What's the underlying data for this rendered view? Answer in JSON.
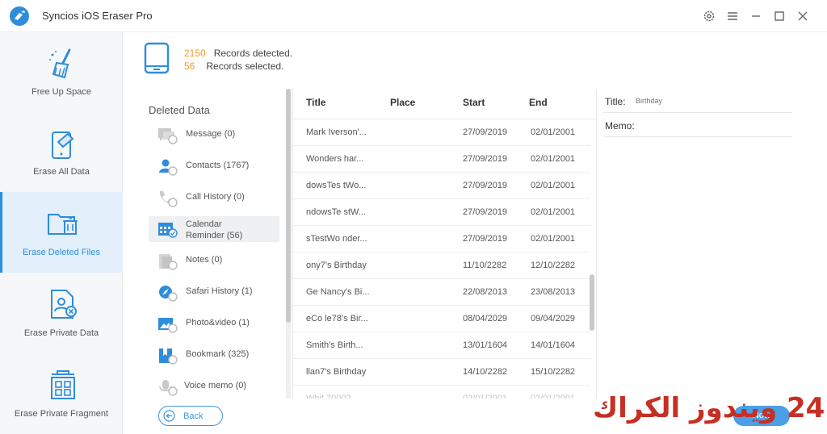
{
  "window": {
    "title": "Syncios iOS Eraser Pro",
    "controls": [
      "settings-icon",
      "menu-icon",
      "minimize-icon",
      "maximize-icon",
      "close-icon"
    ]
  },
  "sidebar": {
    "items": [
      {
        "label": "Free Up Space",
        "icon": "broom-icon"
      },
      {
        "label": "Erase All Data",
        "icon": "phone-erase-icon"
      },
      {
        "label": "Erase Deleted Files",
        "icon": "folder-trash-icon",
        "active": true
      },
      {
        "label": "Erase Private Data",
        "icon": "private-file-icon"
      },
      {
        "label": "Erase Private Fragment",
        "icon": "fragment-icon"
      }
    ]
  },
  "summary": {
    "detected_count": "2150",
    "detected_text": "Records detected.",
    "selected_count": "56",
    "selected_text": "Records selected."
  },
  "categories": {
    "header": "Deleted Data",
    "items": [
      {
        "label": "Message (0)",
        "icon": "message-icon"
      },
      {
        "label": "Contacts (1767)",
        "icon": "contacts-icon"
      },
      {
        "label": "Call History (0)",
        "icon": "phone-call-icon"
      },
      {
        "label": "Calendar Reminder (56)",
        "line1": "Calendar",
        "line2": "Reminder (56)",
        "icon": "calendar-icon",
        "active": true
      },
      {
        "label": "Notes (0)",
        "icon": "notes-icon"
      },
      {
        "label": "Safari History (1)",
        "icon": "safari-icon"
      },
      {
        "label": "Photo&video (1)",
        "icon": "photo-icon"
      },
      {
        "label": "Bookmark (325)",
        "icon": "bookmark-icon"
      },
      {
        "label": "Voice memo (0)",
        "icon": "voice-memo-icon"
      }
    ]
  },
  "table": {
    "columns": [
      "Title",
      "Place",
      "Start",
      "End"
    ],
    "rows": [
      {
        "title": "Mark Iverson'...",
        "place": "",
        "start": "27/09/2019",
        "end": "02/01/2001"
      },
      {
        "title": "Wonders har...",
        "place": "",
        "start": "27/09/2019",
        "end": "02/01/2001"
      },
      {
        "title": "dowsTes tWo...",
        "place": "",
        "start": "27/09/2019",
        "end": "02/01/2001"
      },
      {
        "title": "ndowsTe stW...",
        "place": "",
        "start": "27/09/2019",
        "end": "02/01/2001"
      },
      {
        "title": "sTestWo nder...",
        "place": "",
        "start": "27/09/2019",
        "end": "02/01/2001"
      },
      {
        "title": "ony7's Birthday",
        "place": "",
        "start": "11/10/2282",
        "end": "12/10/2282"
      },
      {
        "title": "Ge Nancy's Bi...",
        "place": "",
        "start": "22/08/2013",
        "end": "23/08/2013"
      },
      {
        "title": "eCo le78's Bir...",
        "place": "",
        "start": "08/04/2029",
        "end": "09/04/2029"
      },
      {
        "title": "Smith's Birth...",
        "place": "",
        "start": "13/01/1604",
        "end": "14/01/1604"
      },
      {
        "title": "llan7's Birthday",
        "place": "",
        "start": "14/10/2282",
        "end": "15/10/2282"
      },
      {
        "title": "Whit 70002...",
        "place": "",
        "start": "02/01/2001",
        "end": "02/01/2001"
      }
    ]
  },
  "detail": {
    "title_label": "Title:",
    "title_value": "Birthday",
    "memo_label": "Memo:",
    "memo_value": ""
  },
  "buttons": {
    "back": "Back",
    "erase_partial": "Now"
  },
  "watermark": "24 ويندوز الكراك",
  "colors": {
    "accent": "#2e8ddb",
    "count_orange": "#f39a2c",
    "watermark_red": "#c62f23"
  }
}
